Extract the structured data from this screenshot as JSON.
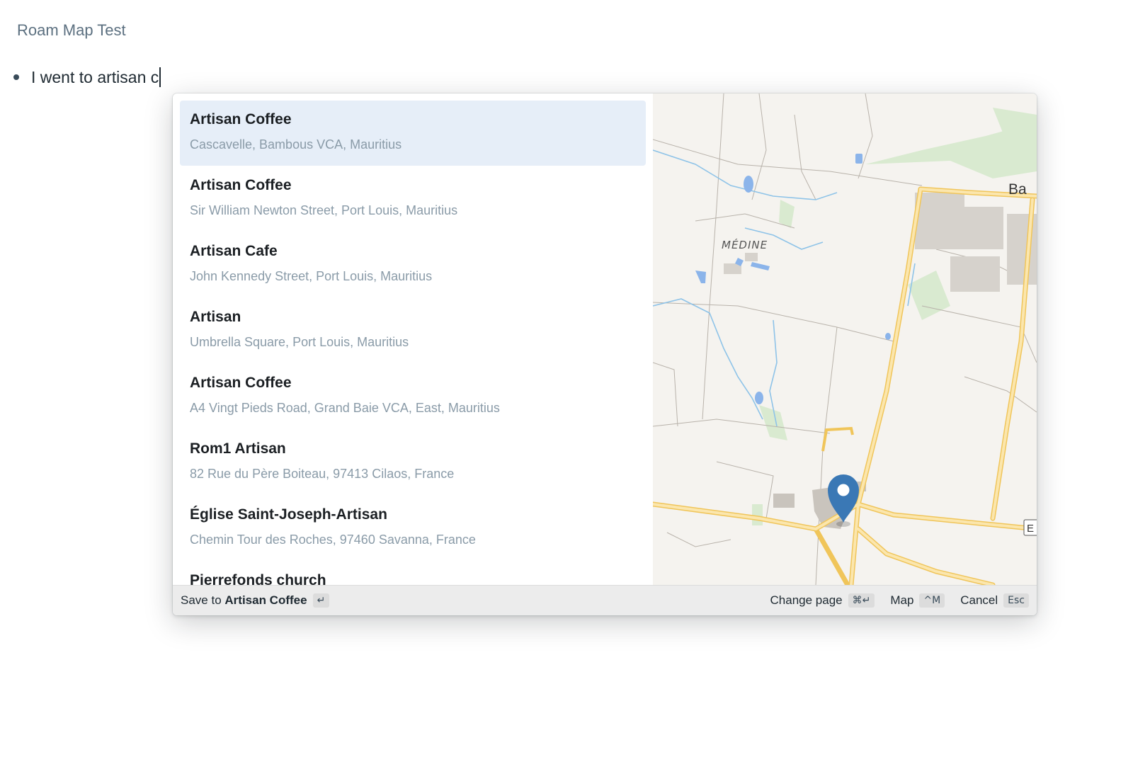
{
  "page": {
    "title": "Roam Map Test"
  },
  "block": {
    "text": "I went to artisan c"
  },
  "results": [
    {
      "name": "Artisan Coffee",
      "address": "Cascavelle, Bambous VCA, Mauritius",
      "active": true
    },
    {
      "name": "Artisan Coffee",
      "address": "Sir William Newton Street, Port Louis, Mauritius"
    },
    {
      "name": "Artisan Cafe",
      "address": "John Kennedy Street, Port Louis, Mauritius"
    },
    {
      "name": "Artisan",
      "address": "Umbrella Square, Port Louis, Mauritius"
    },
    {
      "name": "Artisan Coffee",
      "address": "A4 Vingt Pieds Road, Grand Baie VCA, East, Mauritius"
    },
    {
      "name": "Rom1 Artisan",
      "address": "82 Rue du Père Boiteau, 97413 Cilaos, France"
    },
    {
      "name": "Église Saint-Joseph-Artisan",
      "address": "Chemin Tour des Roches, 97460 Savanna, France"
    },
    {
      "name": "Pierrefonds church",
      "address": ""
    }
  ],
  "map": {
    "place_label": "MÉDINE",
    "edge_label_top": "Ba",
    "edge_label_right": "E",
    "marker_icon": "map-pin-icon",
    "colors": {
      "road": "#f8d27a",
      "water": "#8ec3e8",
      "park": "#d9ead0",
      "marker": "#3a78b5"
    }
  },
  "footer": {
    "save_prefix": "Save to",
    "save_target": "Artisan Coffee",
    "save_key": "↵",
    "change_page_label": "Change page",
    "change_page_key": "⌘↵",
    "map_label": "Map",
    "map_key": "^M",
    "cancel_label": "Cancel",
    "cancel_key": "Esc"
  }
}
